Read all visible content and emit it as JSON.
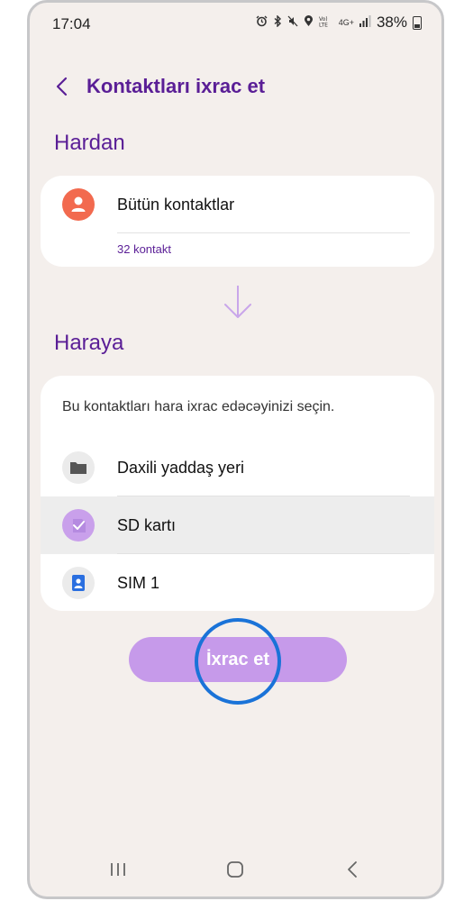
{
  "status_bar": {
    "time": "17:04",
    "icons": [
      "alarm-icon",
      "bluetooth-icon",
      "mute-icon",
      "location-icon",
      "volte-icon",
      "4g-icon",
      "signal-icon"
    ],
    "network_text": "4G+",
    "battery": "38%"
  },
  "header": {
    "title": "Kontaktları ixrac et"
  },
  "from_section": {
    "title": "Hardan",
    "source_label": "Bütün kontaktlar",
    "count_text": "32 kontakt"
  },
  "to_section": {
    "title": "Haraya",
    "instruction": "Bu kontaktları hara ixrac edəcəyinizi seçin.",
    "options": [
      {
        "label": "Daxili yaddaş yeri",
        "icon": "folder-icon",
        "selected": false
      },
      {
        "label": "SD kartı",
        "icon": "sd-card-icon",
        "selected": true
      },
      {
        "label": "SIM 1",
        "icon": "sim-contact-icon",
        "selected": false
      }
    ]
  },
  "export_button": {
    "label": "İxrac et"
  },
  "colors": {
    "accent": "#5a1e96",
    "button": "#c69aea",
    "avatar": "#f26a4f",
    "sim_icon": "#2a6fe0",
    "focus_ring": "#1a73d8",
    "background": "#f4efec"
  }
}
